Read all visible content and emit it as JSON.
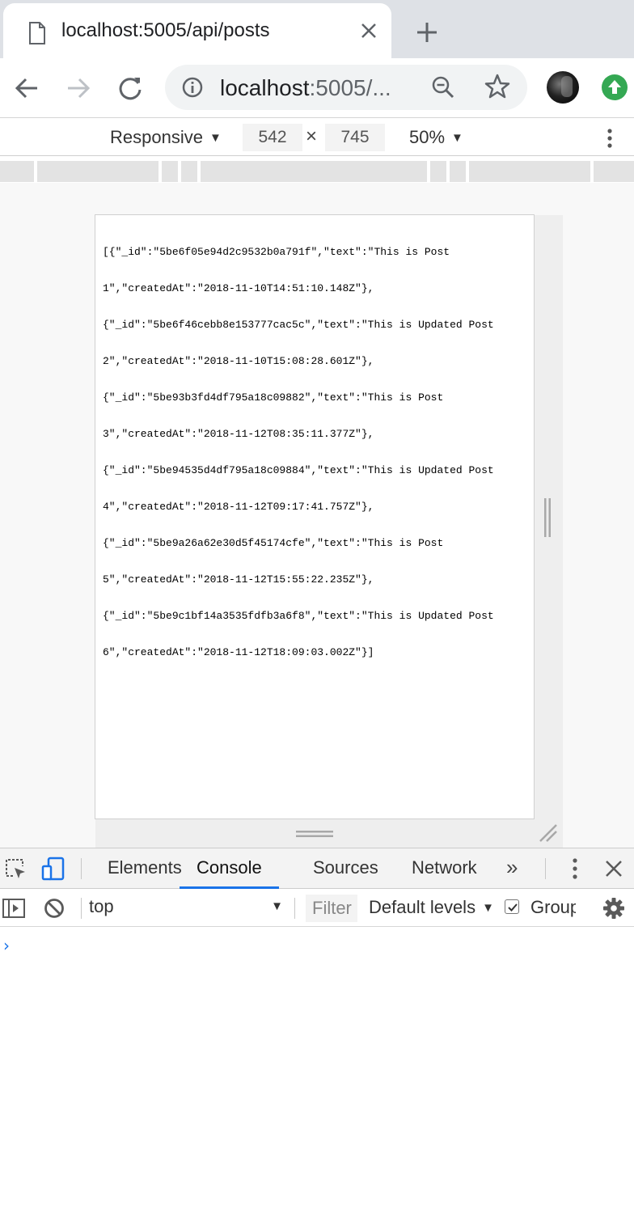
{
  "browser": {
    "tab": {
      "title": "localhost:5005/api/posts"
    },
    "omnibox": {
      "host": "localhost",
      "rest": ":5005/..."
    }
  },
  "device_toolbar": {
    "device": "Responsive",
    "width": "542",
    "height": "745",
    "zoom": "50%",
    "times": "×"
  },
  "page": {
    "json_lines": [
      "[{\"_id\":\"5be6f05e94d2c9532b0a791f\",\"text\":\"This is Post",
      "1\",\"createdAt\":\"2018-11-10T14:51:10.148Z\"},",
      "{\"_id\":\"5be6f46cebb8e153777cac5c\",\"text\":\"This is Updated Post",
      "2\",\"createdAt\":\"2018-11-10T15:08:28.601Z\"},",
      "{\"_id\":\"5be93b3fd4df795a18c09882\",\"text\":\"This is Post",
      "3\",\"createdAt\":\"2018-11-12T08:35:11.377Z\"},",
      "{\"_id\":\"5be94535d4df795a18c09884\",\"text\":\"This is Updated Post",
      "4\",\"createdAt\":\"2018-11-12T09:17:41.757Z\"},",
      "{\"_id\":\"5be9a26a62e30d5f45174cfe\",\"text\":\"This is Post",
      "5\",\"createdAt\":\"2018-11-12T15:55:22.235Z\"},",
      "{\"_id\":\"5be9c1bf14a3535fdfb3a6f8\",\"text\":\"This is Updated Post",
      "6\",\"createdAt\":\"2018-11-12T18:09:03.002Z\"}]"
    ]
  },
  "devtools": {
    "tabs": [
      "Elements",
      "Console",
      "Sources",
      "Network"
    ],
    "active_tab": "Console",
    "more": "»",
    "console": {
      "context": "top",
      "filter_placeholder": "Filter",
      "levels": "Default levels",
      "group_label": "Group",
      "prompt": "›"
    }
  },
  "colors": {
    "accent": "#1a73e8",
    "update_badge": "#34a853"
  }
}
